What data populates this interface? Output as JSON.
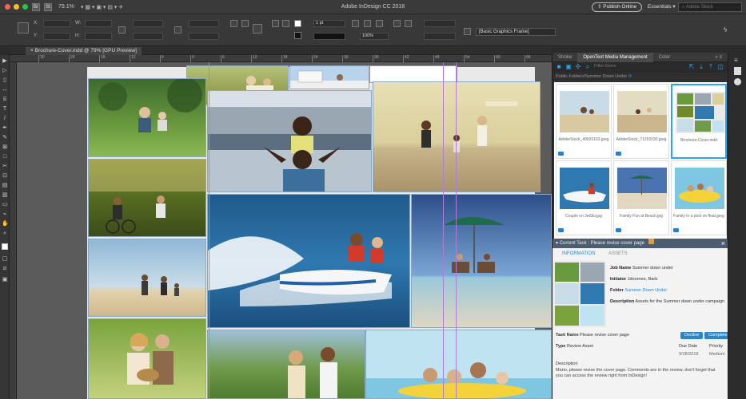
{
  "window": {
    "app_title": "Adobe InDesign CC 2018",
    "zoom": "79.1%",
    "publish_label": "Publish Online",
    "workspace": "Essentials",
    "stock_placeholder": "Adobe Stock"
  },
  "control_panel": {
    "x_label": "X:",
    "y_label": "Y:",
    "w_label": "W:",
    "h_label": "H:",
    "stroke_weight": "1 pt",
    "scale": "100%",
    "frame_style": "[Basic Graphics Frame]"
  },
  "document": {
    "tab_label": "Brochure-Cover.indd @ 79% [GPU Preview]",
    "ruler_ticks": [
      "30",
      "24",
      "18",
      "12",
      "6",
      "0",
      "6",
      "12",
      "18",
      "24",
      "30",
      "36",
      "42",
      "48",
      "54",
      "60",
      "66"
    ]
  },
  "panel": {
    "tabs": [
      "Stroke",
      "OpenText Media Management",
      "Color"
    ],
    "active_tab": "OpenText Media Management",
    "breadcrumb": "Public Folders/Summer Down Under",
    "filter_placeholder": "Filter Items",
    "assets": [
      {
        "name": "AdobeStock_49920163.jpeg"
      },
      {
        "name": "AdobeStock_71292030.jpeg"
      },
      {
        "name": "Brochure-Cover.indd"
      },
      {
        "name": "Couple on JetSki.jpg"
      },
      {
        "name": "Family Fun at Beach.jpg"
      },
      {
        "name": "Family in a pool on float.jpeg"
      }
    ],
    "task": {
      "header": "Current Task : Please revise cover page",
      "subtab_information": "INFORMATION",
      "subtab_assets": "ASSETS",
      "job_name_label": "Job Name",
      "job_name_value": "Summer down under",
      "initiator_label": "Initiator",
      "initiator_value": "Jdoornee, Barb",
      "folder_label": "Folder",
      "folder_value": "Summer Down Under",
      "description_label": "Description",
      "description_value": "Assets for the Summer down under campaign",
      "task_name_label": "Task Name",
      "task_name_value": "Please revise cover page",
      "decline_label": "Decline",
      "complete_label": "Complete",
      "type_label": "Type",
      "type_value": "Review Asset",
      "due_date_label": "Due Date",
      "due_date_value": "9/28/2018",
      "priority_label": "Priority",
      "priority_value": "Medium",
      "desc_label": "Description",
      "desc_text": "Mario, please revise the cover page. Comments are in the review, don't forget that you can access the review right from InDesign!"
    }
  },
  "colors": {
    "accent": "#2ca4ef",
    "guide": "#b07cd8",
    "frame_border": "#8aa7c4"
  }
}
